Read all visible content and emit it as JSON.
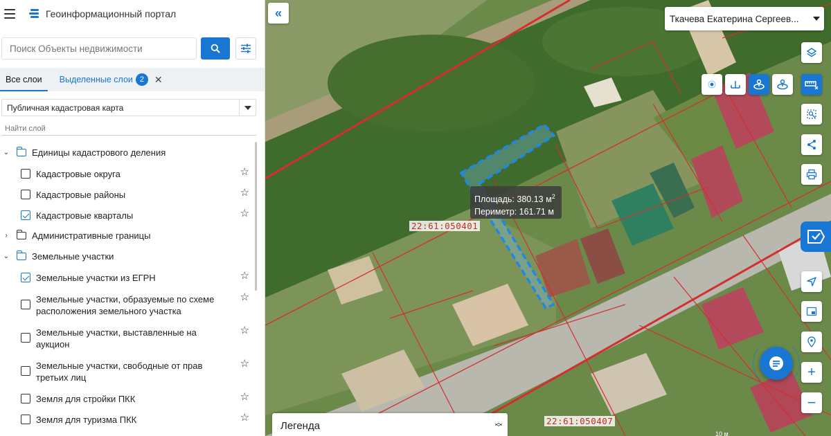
{
  "app": {
    "title": "Геоинформационный портал"
  },
  "search": {
    "placeholder": "Поиск Объекты недвижимости"
  },
  "tabs": {
    "all": "Все слои",
    "selected": "Выделенные слои",
    "selected_count": "2"
  },
  "basemap": {
    "selected": "Публичная кадастровая карта"
  },
  "layer_filter": {
    "placeholder": "Найти слой"
  },
  "tree": {
    "g1": {
      "label": "Единицы кадастрового деления",
      "items": [
        {
          "label": "Кадастровые округа",
          "checked": false
        },
        {
          "label": "Кадастровые районы",
          "checked": false
        },
        {
          "label": "Кадастровые кварталы",
          "checked": true
        }
      ]
    },
    "g2": {
      "label": "Административные границы"
    },
    "g3": {
      "label": "Земельные участки",
      "items": [
        {
          "label": "Земельные участки из ЕГРН",
          "checked": true
        },
        {
          "label": "Земельные участки, образуемые по схеме расположения земельного участка",
          "checked": false
        },
        {
          "label": "Земельные участки, выставленные на аукцион",
          "checked": false
        },
        {
          "label": "Земельные участки, свободные от прав третьих лиц",
          "checked": false
        },
        {
          "label": "Земля для стройки ПКК",
          "checked": false
        },
        {
          "label": "Земля для туризма ПКК",
          "checked": false
        }
      ]
    }
  },
  "user": {
    "name": "Ткачева Екатерина Сергеев..."
  },
  "map": {
    "quarter_labels": [
      "22:61:050401",
      "22:61:050407"
    ],
    "measure": {
      "area_label": "Площадь:",
      "area_value": "380.13 м",
      "area_sup": "2",
      "perimeter_label": "Периметр:",
      "perimeter_value": "161.71 м"
    },
    "legend_title": "Легенда",
    "scale_text": "10 м"
  },
  "colors": {
    "accent": "#1976d2",
    "boundary": "#d32f2f"
  }
}
